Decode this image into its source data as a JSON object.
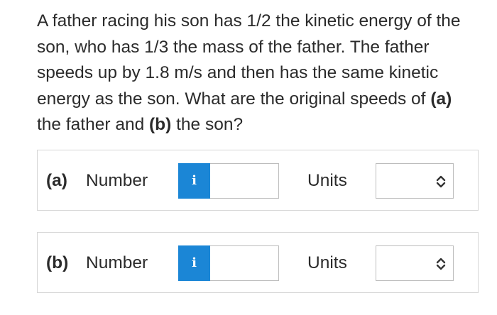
{
  "question": {
    "text_1": "A father racing his son has 1/2 the kinetic energy of the son, who has 1/3 the mass of the father. The father speeds up by 1.8 m/s and then has the same kinetic energy as the son. What are the original speeds of ",
    "part_a_ref": "(a)",
    "text_2": " the father and ",
    "part_b_ref": "(b)",
    "text_3": " the son?"
  },
  "answers": [
    {
      "part_label": "(a)",
      "number_label": "Number",
      "info_icon": "i",
      "number_value": "",
      "units_label": "Units",
      "units_value": ""
    },
    {
      "part_label": "(b)",
      "number_label": "Number",
      "info_icon": "i",
      "number_value": "",
      "units_label": "Units",
      "units_value": ""
    }
  ],
  "colors": {
    "info_button": "#1b86d6",
    "border": "#d6d6d6",
    "text": "#2b2b2b"
  }
}
